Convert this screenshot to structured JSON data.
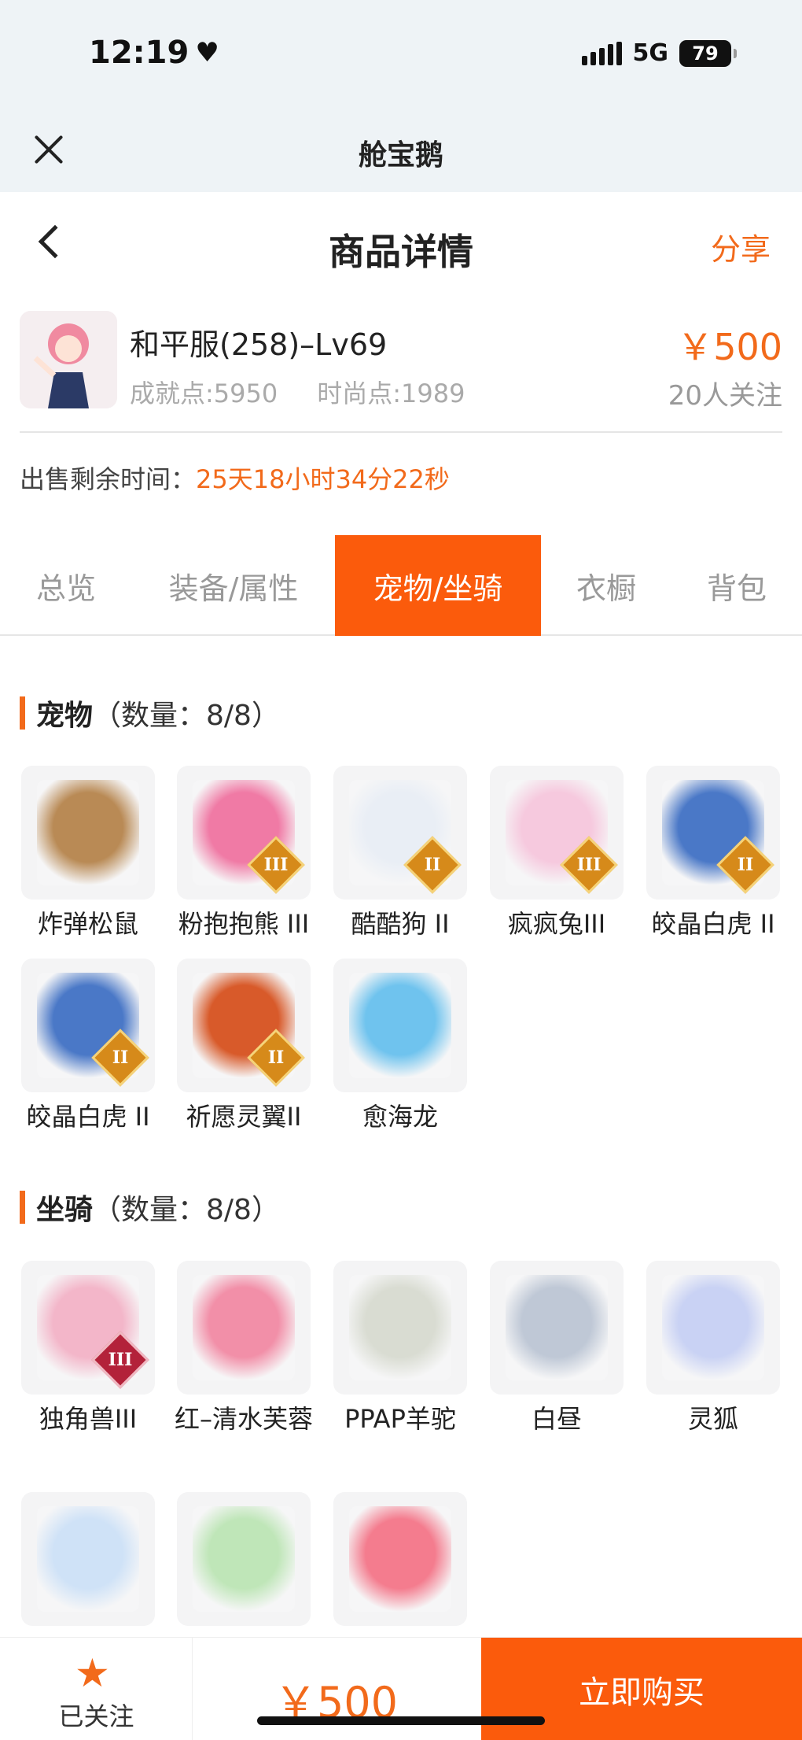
{
  "status_bar": {
    "time": "12:19",
    "network": "5G",
    "battery": "79"
  },
  "app": {
    "title": "舱宝鹅"
  },
  "nav": {
    "title": "商品详情",
    "share": "分享"
  },
  "product": {
    "name": "和平服(258)–Lv69",
    "achievement": "成就点:5950",
    "fashion": "时尚点:1989",
    "price": "￥500",
    "followers": "20人关注"
  },
  "sale": {
    "label": "出售剩余时间：",
    "remaining": "25天18小时34分22秒"
  },
  "tabs": [
    {
      "label": "总览",
      "active": false
    },
    {
      "label": "装备/属性",
      "active": false
    },
    {
      "label": "宠物/坐骑",
      "active": true
    },
    {
      "label": "衣橱",
      "active": false
    },
    {
      "label": "背包",
      "active": false
    }
  ],
  "pets": {
    "title": "宠物",
    "count": "（数量：8/8）",
    "items": [
      {
        "name": "炸弹松鼠",
        "tier": "",
        "color": "#b98a55"
      },
      {
        "name": "粉抱抱熊 III",
        "tier": "III",
        "color": "#f07aa5"
      },
      {
        "name": "酷酷狗 II",
        "tier": "II",
        "color": "#e9eef5"
      },
      {
        "name": "疯疯兔III",
        "tier": "III",
        "color": "#f6c9de"
      },
      {
        "name": "皎晶白虎 II",
        "tier": "II",
        "color": "#4a78c7"
      },
      {
        "name": "皎晶白虎 II",
        "tier": "II",
        "color": "#4a78c7"
      },
      {
        "name": "祈愿灵翼II",
        "tier": "II",
        "color": "#d85a2a"
      },
      {
        "name": "愈海龙",
        "tier": "",
        "color": "#6fc3ee"
      }
    ]
  },
  "mounts": {
    "title": "坐骑",
    "count": "（数量：8/8）",
    "items": [
      {
        "name": "独角兽III",
        "tier": "III",
        "color": "#f3b6c9"
      },
      {
        "name": "红–清水芙蓉",
        "tier": "",
        "color": "#f28fa8"
      },
      {
        "name": "PPAP羊驼",
        "tier": "",
        "color": "#d9dcd2"
      },
      {
        "name": "白昼",
        "tier": "",
        "color": "#bfc8d6"
      },
      {
        "name": "灵狐",
        "tier": "",
        "color": "#c9d2f4"
      },
      {
        "name": "",
        "tier": "",
        "color": "#cfe2f7"
      },
      {
        "name": "",
        "tier": "",
        "color": "#bfe6b8"
      },
      {
        "name": "",
        "tier": "",
        "color": "#f47c8e"
      }
    ]
  },
  "bottom": {
    "follow_label": "已关注",
    "price": "￥500",
    "buy_label": "立即购买"
  }
}
